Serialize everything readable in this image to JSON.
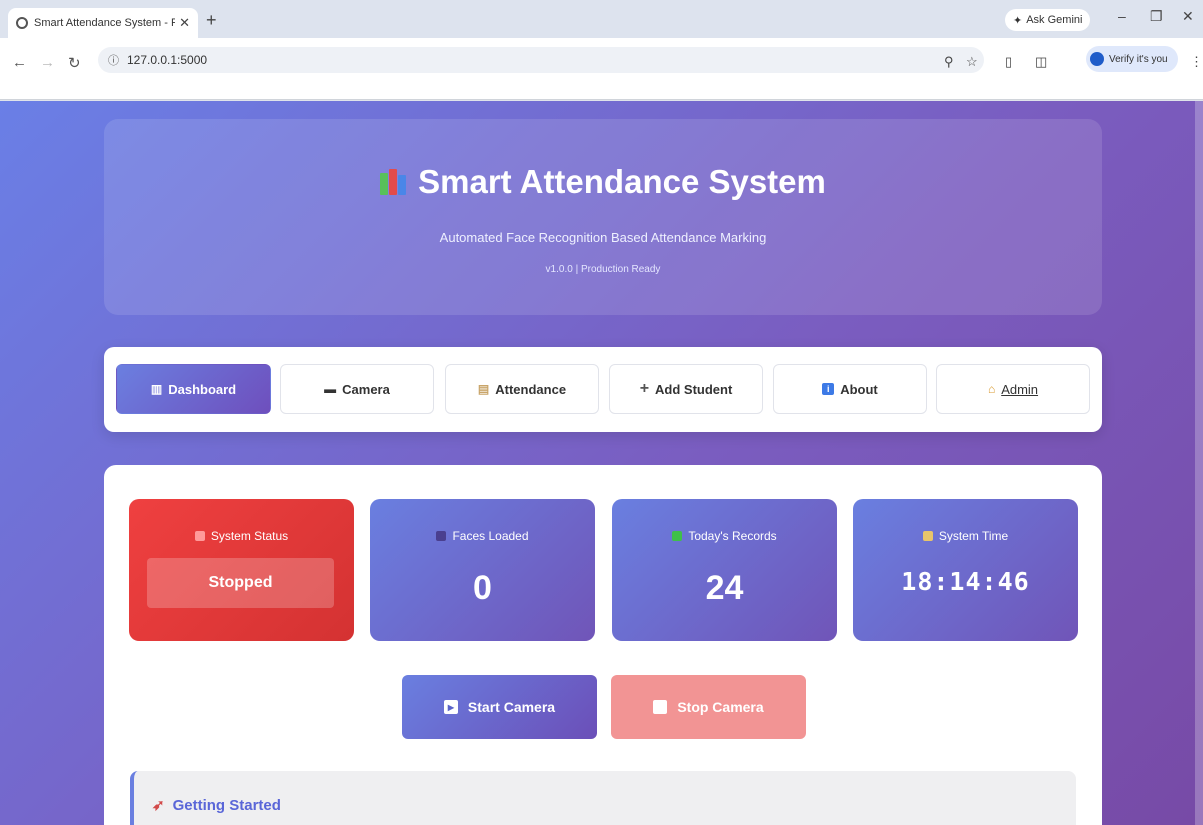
{
  "browser": {
    "tab_title": "Smart Attendance System - Fa",
    "tab_close": "✕",
    "new_tab": "+",
    "gemini": "Ask Gemini",
    "url": "127.0.0.1:5000",
    "verify": "Verify it's you",
    "minimize": "–",
    "restore": "❐",
    "close": "✕"
  },
  "hero": {
    "title": "Smart Attendance System",
    "subtitle": "Automated Face Recognition Based Attendance Marking",
    "version": "v1.0.0 | Production Ready"
  },
  "nav": {
    "items": [
      {
        "label": "Dashboard",
        "icon": "chart-icon"
      },
      {
        "label": "Camera",
        "icon": "camera-icon"
      },
      {
        "label": "Attendance",
        "icon": "clipboard-icon"
      },
      {
        "label": "Add Student",
        "icon": "plus-icon"
      },
      {
        "label": "About",
        "icon": "info-icon"
      },
      {
        "label": "Admin",
        "icon": "lock-icon"
      }
    ]
  },
  "stats": {
    "status": {
      "label": "System Status",
      "value": "Stopped"
    },
    "faces": {
      "label": "Faces Loaded",
      "value": "0"
    },
    "records": {
      "label": "Today's Records",
      "value": "24"
    },
    "time": {
      "label": "System Time",
      "value": "18:14:46"
    }
  },
  "camera": {
    "start": "Start Camera",
    "stop": "Stop Camera"
  },
  "getting_started": {
    "title": "Getting Started"
  },
  "colors": {
    "accent_start": "#6a7fe0",
    "accent_end": "#7055b8",
    "status_stopped": "#ef4040",
    "stop_button": "#f29494"
  }
}
